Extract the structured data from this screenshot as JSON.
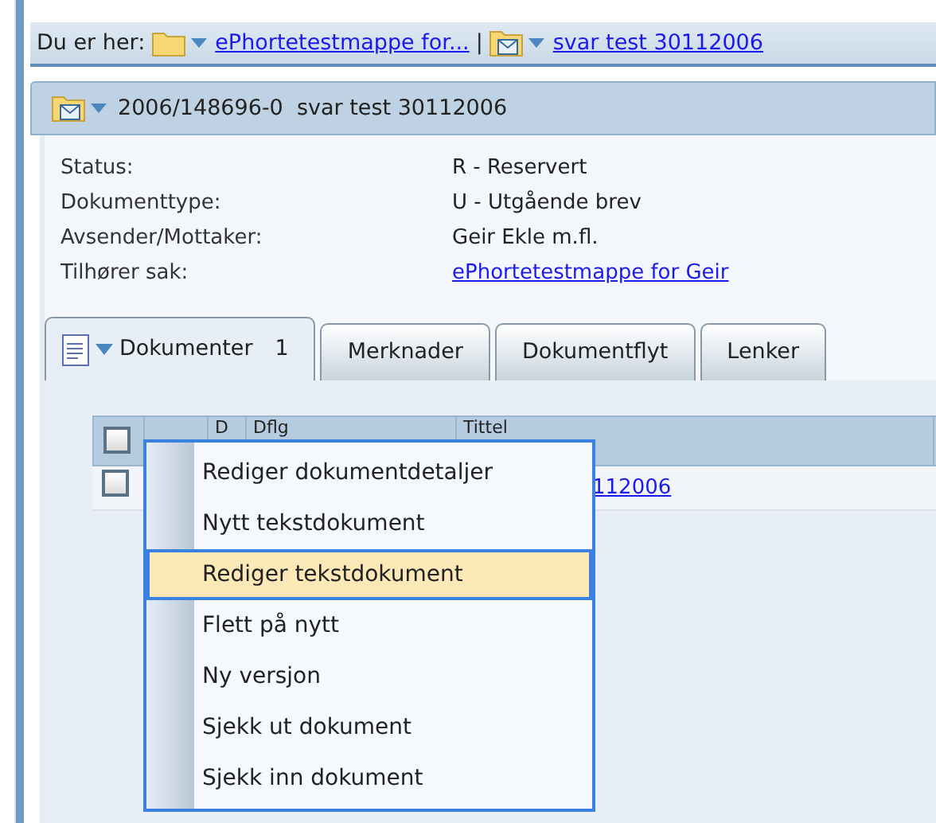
{
  "breadcrumb": {
    "label": "Du er her:",
    "separator": "|",
    "items": [
      {
        "text": "ePhortetestmappe for...",
        "kind": "folder"
      },
      {
        "text": "svar test 30112006",
        "kind": "mail"
      }
    ]
  },
  "header": {
    "title": "2006/148696-0  svar test 30112006"
  },
  "fields": [
    {
      "label": "Status:",
      "value": "R - Reservert",
      "kind": "text"
    },
    {
      "label": "Dokumenttype:",
      "value": "U - Utgående brev",
      "kind": "text"
    },
    {
      "label": "Avsender/Mottaker:",
      "value": "Geir Ekle m.fl.",
      "kind": "text"
    },
    {
      "label": "Tilhører sak:",
      "value": "ePhortetestmappe for Geir",
      "kind": "link"
    }
  ],
  "tabs": [
    {
      "label": "Dokumenter",
      "count": "1",
      "selected": true
    },
    {
      "label": "Merknader",
      "selected": false
    },
    {
      "label": "Dokumentflyt",
      "selected": false
    },
    {
      "label": "Lenker",
      "selected": false
    }
  ],
  "table": {
    "header_checked": false,
    "columns": [
      "D",
      "Dflg",
      "Tittel"
    ],
    "rows": [
      {
        "checked": false,
        "title": "112006"
      }
    ]
  },
  "context_menu": {
    "items": [
      {
        "label": "Rediger dokumentdetaljer",
        "selected": false
      },
      {
        "label": "Nytt tekstdokument",
        "selected": false
      },
      {
        "label": "Rediger tekstdokument",
        "selected": true
      },
      {
        "label": "Flett på nytt",
        "selected": false
      },
      {
        "label": "Ny versjon",
        "selected": false
      },
      {
        "label": "Sjekk ut dokument",
        "selected": false
      },
      {
        "label": "Sjekk inn dokument",
        "selected": false
      }
    ]
  }
}
